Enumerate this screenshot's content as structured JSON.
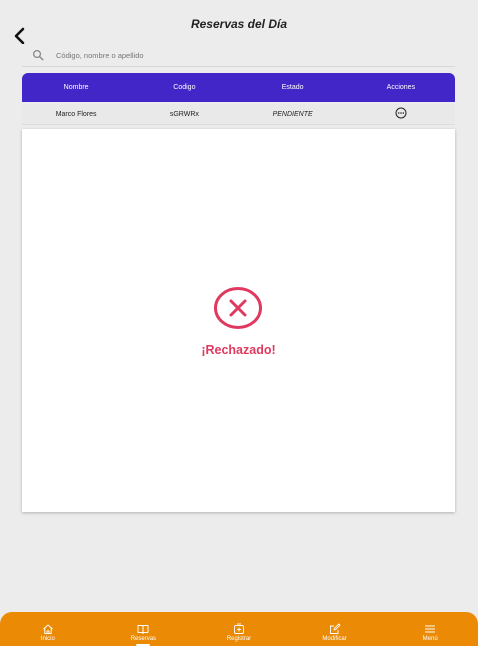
{
  "header": {
    "title": "Reservas del Día"
  },
  "search": {
    "placeholder": "Código, nombre o apellido",
    "value": ""
  },
  "table": {
    "columns": [
      "Nombre",
      "Codigo",
      "Estado",
      "Acciones"
    ],
    "rows": [
      {
        "nombre": "Marco Flores",
        "codigo": "sGRWRx",
        "estado": "PENDIENTE"
      }
    ]
  },
  "modal": {
    "result_text": "¡Rechazado!",
    "accent_color": "#e0395f"
  },
  "nav": {
    "items": [
      {
        "label": "Inicio",
        "icon": "home-icon"
      },
      {
        "label": "Reservas",
        "icon": "book-icon",
        "active": true
      },
      {
        "label": "Registrar",
        "icon": "add-icon"
      },
      {
        "label": "Modificar",
        "icon": "edit-icon"
      },
      {
        "label": "Menú",
        "icon": "menu-icon"
      }
    ]
  },
  "colors": {
    "header_purple": "#4326c8",
    "nav_orange": "#ea8a05",
    "background": "#ececec"
  }
}
